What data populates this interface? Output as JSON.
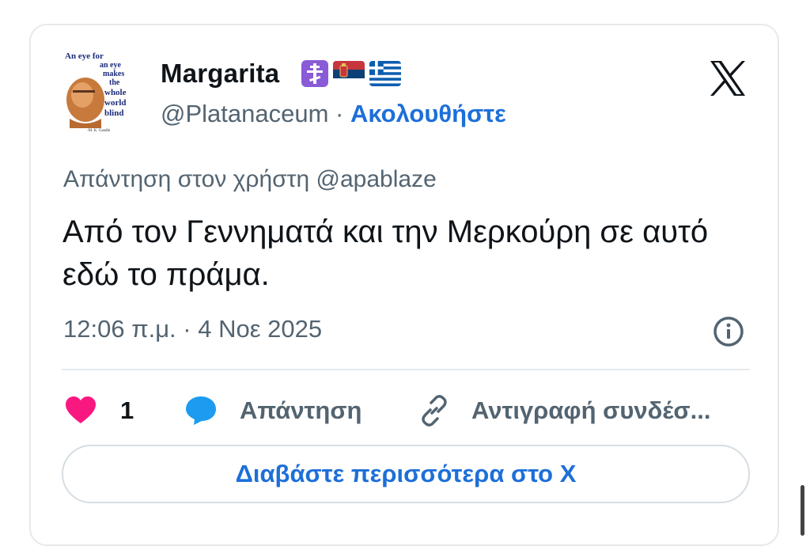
{
  "tweet": {
    "display_name": "Margarita",
    "badges": [
      "orthodox-cross-icon",
      "serbia-flag-icon",
      "greece-flag-icon"
    ],
    "handle": "@Platanaceum",
    "separator": " · ",
    "follow_label": "Ακολουθήστε",
    "reply_to": "Απάντηση στον χρήστη @apablaze",
    "text": "Από τον Γεννηματά και την Μερκούρη σε αυτό εδώ το πράμα.",
    "timestamp": "12:06 π.μ. · 4 Νοε 2025",
    "avatar_quote": {
      "lines": [
        "An eye for",
        "an eye",
        "makes",
        "the",
        "whole",
        "world",
        "blind"
      ],
      "attribution": "-M. K. Gandhi"
    }
  },
  "actions": {
    "like_count": "1",
    "reply_label": "Απάντηση",
    "copy_link_label": "Αντιγραφή συνδέσ..."
  },
  "read_more_label": "Διαβάστε περισσότερα στο Χ",
  "colors": {
    "accent": "#1d6fd9",
    "like": "#f91880",
    "reply_bubble": "#1d9bf0",
    "muted_text": "#536471",
    "border": "#e6e9ec"
  }
}
